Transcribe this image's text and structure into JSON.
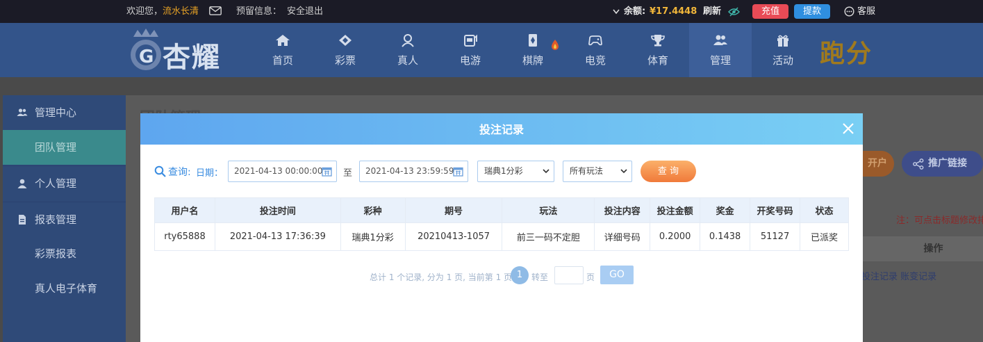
{
  "topbar": {
    "welcome": "欢迎您，",
    "username": "流水长清",
    "reserved_info_label": "预留信息：",
    "logout": "安全退出",
    "balance_label": "余额:",
    "balance_value": "¥17.4448",
    "refresh": "刷新",
    "charge": "充值",
    "withdraw": "提款",
    "service": "客服"
  },
  "nav": {
    "logo_text": "杏耀",
    "items": [
      {
        "label": "首页",
        "icon": "home-icon"
      },
      {
        "label": "彩票",
        "icon": "diamond-icon"
      },
      {
        "label": "真人",
        "icon": "person-icon"
      },
      {
        "label": "电游",
        "icon": "slot-icon"
      },
      {
        "label": "棋牌",
        "icon": "cards-icon"
      },
      {
        "label": "电竞",
        "icon": "gamepad-icon"
      },
      {
        "label": "体育",
        "icon": "trophy-icon"
      },
      {
        "label": "管理",
        "icon": "users-icon"
      },
      {
        "label": "活动",
        "icon": "gift-icon"
      }
    ],
    "paofen": "跑分"
  },
  "sidebar": {
    "items": [
      {
        "label": "管理中心"
      },
      {
        "label": "团队管理"
      },
      {
        "label": "个人管理"
      },
      {
        "label": "报表管理"
      },
      {
        "label": "彩票报表"
      },
      {
        "label": "真人电子体育"
      }
    ]
  },
  "background": {
    "page_title": "团队管理",
    "open_account": "开户",
    "promo_link": "推广链接",
    "note": "注：可点击标题修改排序",
    "operation_header": "操作",
    "row_links": "投注记录  账变记录"
  },
  "modal": {
    "title": "投注记录",
    "query_label": "查询:",
    "date_label": "日期：",
    "start_date": "2021-04-13 00:00:00",
    "to_label": "至",
    "end_date": "2021-04-13 23:59:59",
    "lottery_select": "瑞典1分彩",
    "play_select": "所有玩法",
    "query_button": "查 询",
    "columns": [
      "用户名",
      "投注时间",
      "彩种",
      "期号",
      "玩法",
      "投注内容",
      "投注金额",
      "奖金",
      "开奖号码",
      "状态"
    ],
    "rows": [
      {
        "username": "rty65888",
        "bet_time": "2021-04-13 17:36:39",
        "lottery": "瑞典1分彩",
        "issue": "20210413-1057",
        "play": "前三一码不定胆",
        "content": "详细号码",
        "amount": "0.2000",
        "bonus": "0.1438",
        "draw_number": "51127",
        "status": "已派奖"
      }
    ],
    "pager": {
      "summary": "总计 1 个记录, 分为 1 页, 当前第 1 页",
      "current_page": "1",
      "jump_label": "转至",
      "page_unit": "页",
      "go": "GO"
    }
  },
  "colors": {
    "modal_header_start": "#5ea6ef",
    "modal_header_end": "#79cff4",
    "accent_blue": "#3a8ce0",
    "query_button": "#f07a3a",
    "status_paid": "#e0872a",
    "detail_link": "#28a03a"
  }
}
